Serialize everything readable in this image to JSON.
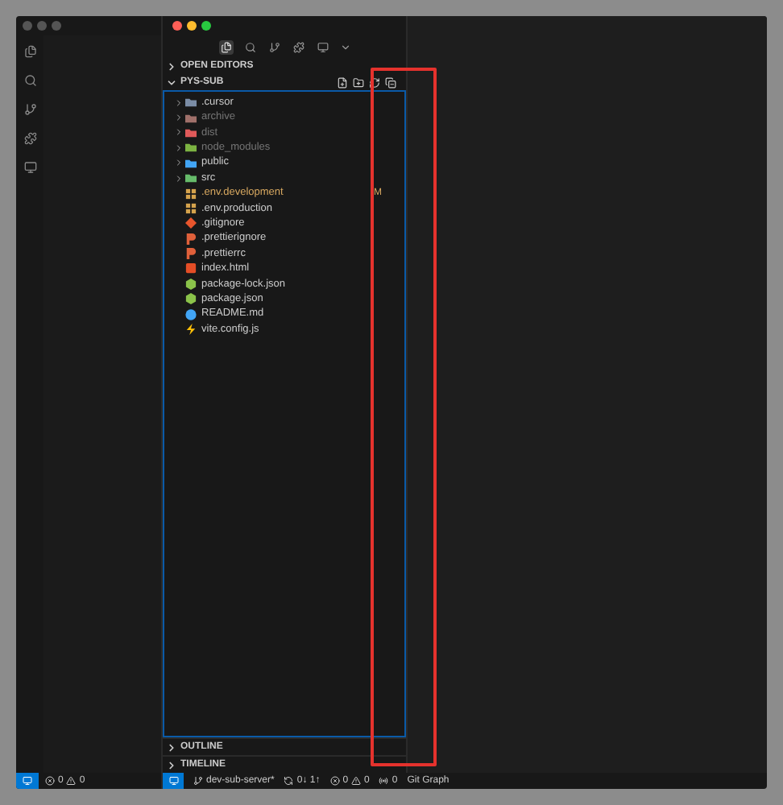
{
  "left_window": {
    "status_bar": {
      "errors": "0",
      "warnings": "0"
    }
  },
  "views": [
    {
      "kind": "files",
      "selected": true
    },
    {
      "kind": "search",
      "selected": false
    },
    {
      "kind": "source-control",
      "selected": false
    },
    {
      "kind": "extensions",
      "selected": false
    },
    {
      "kind": "remote",
      "selected": false
    }
  ],
  "sections": [
    {
      "title": "OPEN EDITORS",
      "expanded": false
    },
    {
      "title": "PYS-SUB",
      "expanded": true
    }
  ],
  "tree": [
    {
      "name": ".cursor",
      "kind": "folder",
      "color": "#7b8da6",
      "dimmed": false
    },
    {
      "name": "archive",
      "kind": "folder",
      "color": "#a0706a",
      "dimmed": true
    },
    {
      "name": "dist",
      "kind": "folder",
      "color": "#e05a5a",
      "dimmed": true
    },
    {
      "name": "node_modules",
      "kind": "folder",
      "color": "#7cb342",
      "dimmed": true
    },
    {
      "name": "public",
      "kind": "folder",
      "color": "#42a5f5",
      "dimmed": false
    },
    {
      "name": "src",
      "kind": "folder",
      "color": "#66bb6a",
      "dimmed": false
    },
    {
      "name": ".env.development",
      "kind": "env",
      "color": "#d4a24c",
      "dimmed": false,
      "modified": true,
      "status": "M"
    },
    {
      "name": ".env.production",
      "kind": "env",
      "color": "#d4a24c",
      "dimmed": false,
      "modified": false
    },
    {
      "name": ".gitignore",
      "kind": "git",
      "color": "#e8552c",
      "dimmed": false,
      "modified": false
    },
    {
      "name": ".prettierignore",
      "kind": "prettier",
      "color": "#e0603a",
      "dimmed": false,
      "modified": false
    },
    {
      "name": ".prettierrc",
      "kind": "prettier",
      "color": "#e0603a",
      "dimmed": false,
      "modified": false
    },
    {
      "name": "index.html",
      "kind": "html",
      "color": "#e44d26",
      "dimmed": false,
      "modified": false
    },
    {
      "name": "package-lock.json",
      "kind": "npm",
      "color": "#8bc34a",
      "dimmed": false,
      "modified": false
    },
    {
      "name": "package.json",
      "kind": "npm",
      "color": "#8bc34a",
      "dimmed": false,
      "modified": false
    },
    {
      "name": "README.md",
      "kind": "readme",
      "color": "#42a5f5",
      "dimmed": false,
      "modified": false
    },
    {
      "name": "vite.config.js",
      "kind": "vite",
      "color": "#ffc107",
      "dimmed": false,
      "modified": false
    }
  ],
  "bottom_sections": [
    {
      "title": "OUTLINE",
      "expanded": false
    },
    {
      "title": "TIMELINE",
      "expanded": false
    }
  ],
  "status_bar": {
    "branch": "dev-sub-server*",
    "sync": "0↓ 1↑",
    "errors": "0",
    "warnings": "0",
    "ports": "0",
    "git_graph": "Git Graph"
  }
}
